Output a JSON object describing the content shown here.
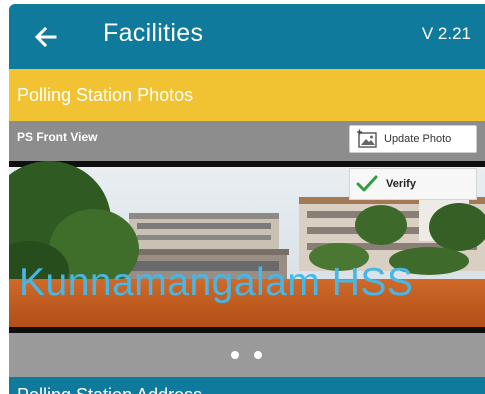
{
  "appbar": {
    "title": "Facilities",
    "version": "V 2.21",
    "back_icon": "arrow-left-icon",
    "color": "#0f7a9c"
  },
  "section": {
    "title": "Polling Station Photos",
    "color": "#f1c232"
  },
  "photo_card": {
    "label": "PS Front View",
    "update_button": {
      "label": "Update Photo",
      "icon": "camera-photo-icon"
    },
    "verify_button": {
      "label": "Verify",
      "icon": "check-icon",
      "icon_color": "#2e9e3f"
    },
    "watermark_text": "Kunnamangalam HSS",
    "pager": {
      "total": 2,
      "current": 1
    }
  },
  "next_section": {
    "title": "Polling Station Address"
  }
}
